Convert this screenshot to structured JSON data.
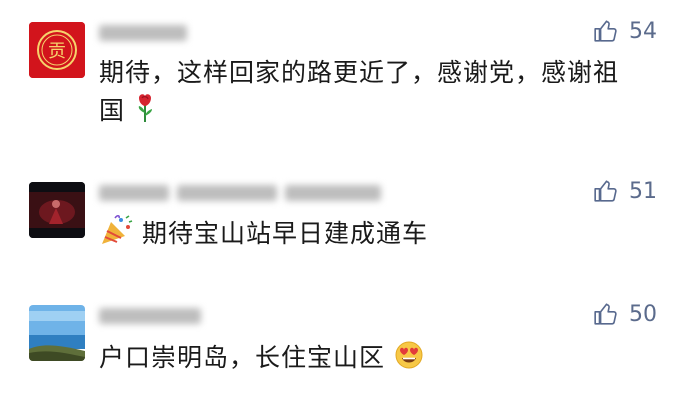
{
  "comments": [
    {
      "avatar": "red-seal-avatar",
      "likes": "54",
      "text": "期待，这样回家的路更近了，感谢党，感谢祖国",
      "emoji": "rose-emoji"
    },
    {
      "avatar": "dark-stage-avatar",
      "likes": "51",
      "text": "期待宝山站早日建成通车",
      "emoji": "party-popper-emoji"
    },
    {
      "avatar": "seaside-avatar",
      "likes": "50",
      "text": "户口崇明岛，长住宝山区",
      "emoji": "heart-eyes-emoji"
    }
  ],
  "colors": {
    "like": "#58698e",
    "text": "#1a1a1a"
  }
}
